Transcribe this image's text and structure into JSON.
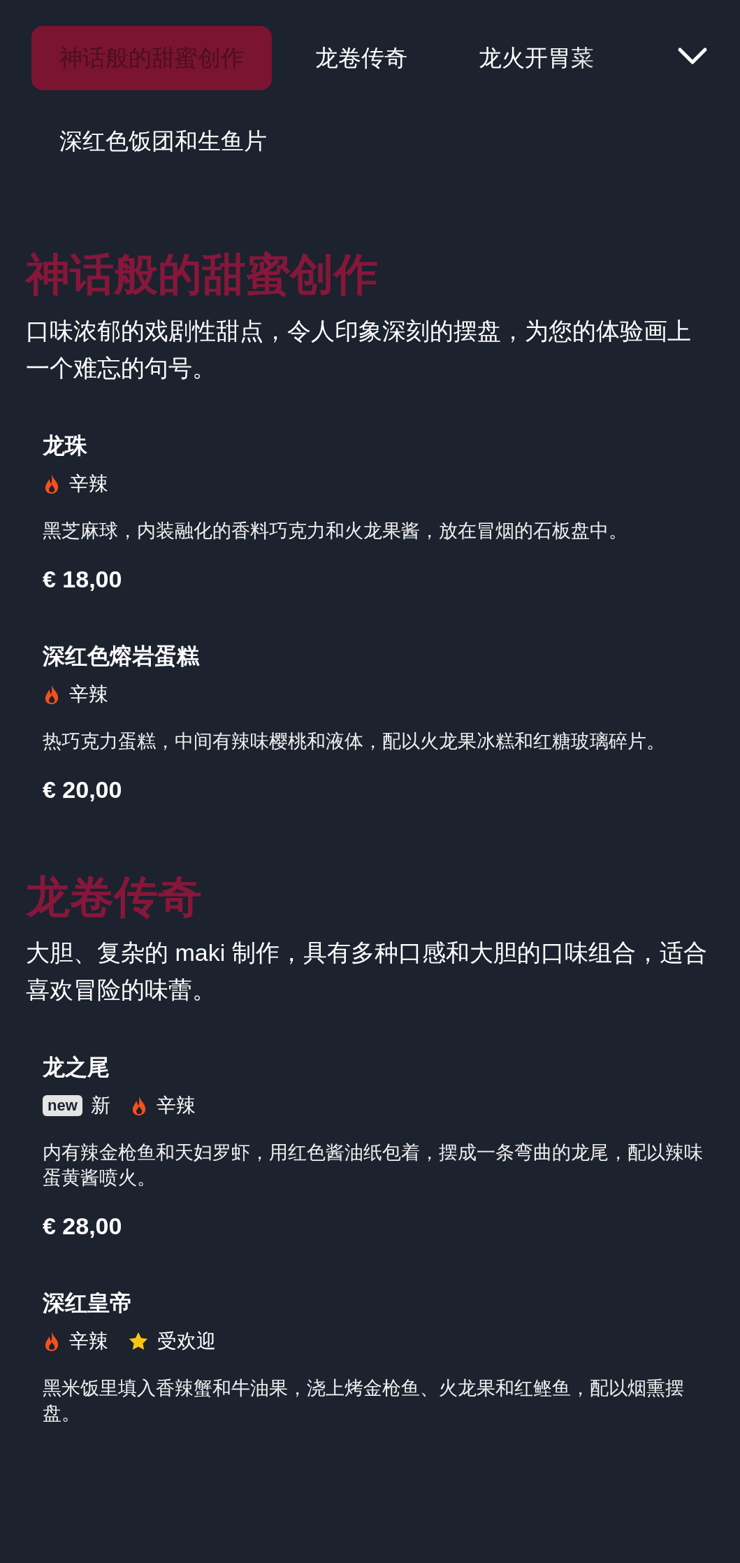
{
  "tabs": [
    {
      "label": "神话般的甜蜜创作",
      "selected": true
    },
    {
      "label": "龙卷传奇",
      "selected": false
    },
    {
      "label": "龙火开胃菜",
      "selected": false
    },
    {
      "label": "深红色饭团和生鱼片",
      "selected": false
    }
  ],
  "tabs_expanded": false,
  "sections": [
    {
      "title": "神话般的甜蜜创作",
      "description": "口味浓郁的戏剧性甜点，令人印象深刻的摆盘，为您的体验画上一个难忘的句号。",
      "items": [
        {
          "name": "龙珠",
          "tags": [
            {
              "kind": "spicy",
              "label": "辛辣"
            }
          ],
          "description": "黑芝麻球，内装融化的香料巧克力和火龙果酱，放在冒烟的石板盘中。",
          "price": "€ 18,00"
        },
        {
          "name": "深红色熔岩蛋糕",
          "tags": [
            {
              "kind": "spicy",
              "label": "辛辣"
            }
          ],
          "description": "热巧克力蛋糕，中间有辣味樱桃和液体，配以火龙果冰糕和红糖玻璃碎片。",
          "price": "€ 20,00"
        }
      ]
    },
    {
      "title": "龙卷传奇",
      "description": "大胆、复杂的 maki 制作，具有多种口感和大胆的口味组合，适合喜欢冒险的味蕾。",
      "items": [
        {
          "name": "龙之尾",
          "tags": [
            {
              "kind": "new",
              "badge": "new",
              "label": "新"
            },
            {
              "kind": "spicy",
              "label": "辛辣"
            }
          ],
          "description": "内有辣金枪鱼和天妇罗虾，用红色酱油纸包着，摆成一条弯曲的龙尾，配以辣味蛋黄酱喷火。",
          "price": "€ 28,00"
        },
        {
          "name": "深红皇帝",
          "tags": [
            {
              "kind": "spicy",
              "label": "辛辣"
            },
            {
              "kind": "popular",
              "label": "受欢迎"
            }
          ],
          "description": "黑米饭里填入香辣蟹和牛油果，浇上烤金枪鱼、火龙果和红鲣鱼，配以烟熏摆盘。"
        }
      ]
    }
  ]
}
